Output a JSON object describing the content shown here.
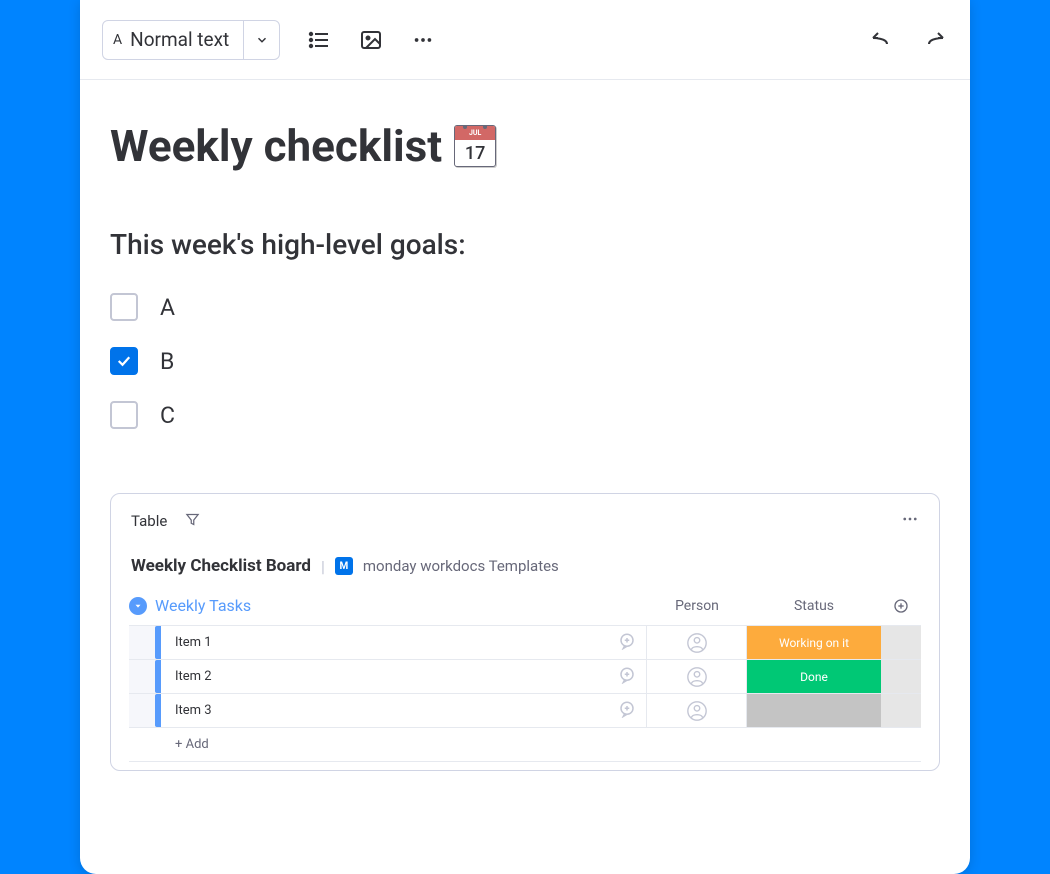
{
  "toolbar": {
    "text_style": "Normal text"
  },
  "doc": {
    "title": "Weekly checklist",
    "calendar_top": "JUL",
    "calendar_day": "17",
    "subtitle": "This week's high-level goals:",
    "checks": [
      {
        "label": "A",
        "checked": false
      },
      {
        "label": "B",
        "checked": true
      },
      {
        "label": "C",
        "checked": false
      }
    ]
  },
  "board": {
    "tab": "Table",
    "title": "Weekly Checklist Board",
    "badge": "M",
    "meta": "monday workdocs Templates",
    "group_name": "Weekly Tasks",
    "columns": {
      "person": "Person",
      "status": "Status"
    },
    "rows": [
      {
        "name": "Item 1",
        "status": "Working on it",
        "status_class": "status-working"
      },
      {
        "name": "Item 2",
        "status": "Done",
        "status_class": "status-done"
      },
      {
        "name": "Item 3",
        "status": "",
        "status_class": "status-blank"
      }
    ],
    "add_row": "+ Add"
  }
}
